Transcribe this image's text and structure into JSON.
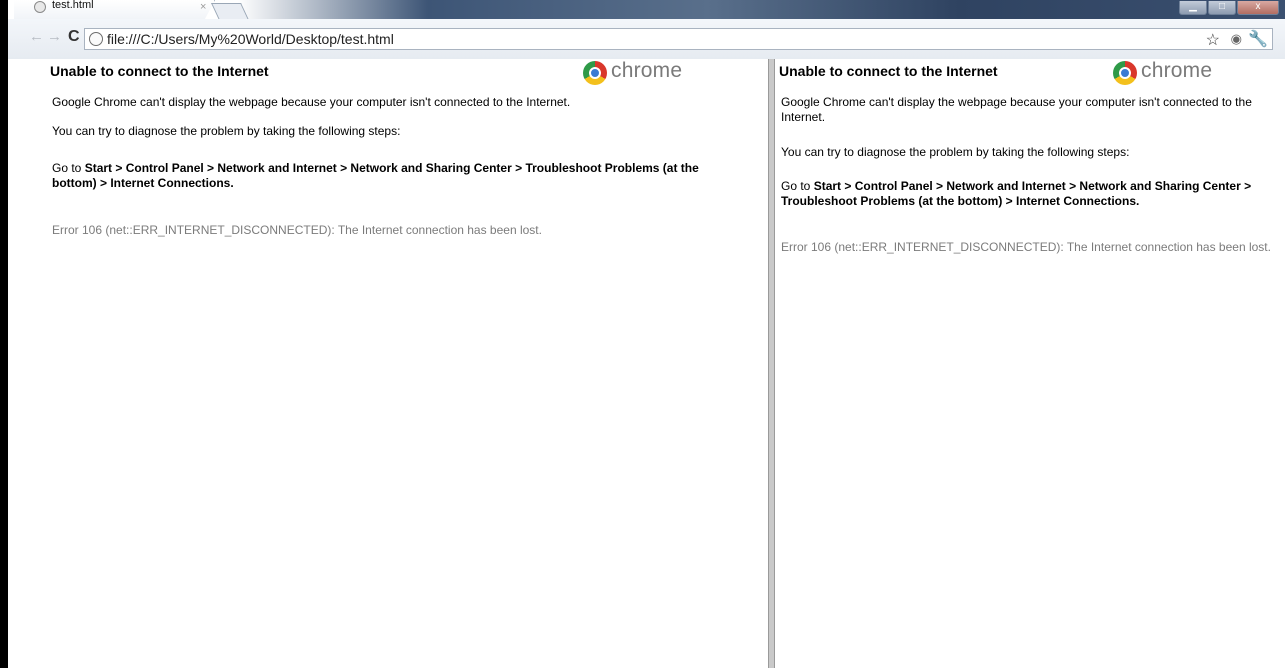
{
  "tab": {
    "title": "test.html",
    "close": "×"
  },
  "window_controls": {
    "minimize": "▁",
    "maximize": "□",
    "close": "x"
  },
  "toolbar": {
    "back": "←",
    "forward": "→",
    "reload": "C",
    "url": "file:///C:/Users/My%20World/Desktop/test.html"
  },
  "error_page": {
    "title": "Unable to connect to the Internet",
    "logo_text": "chrome",
    "line1": "Google Chrome can't display the webpage because your computer isn't connected to the Internet.",
    "line1_a": "Google Chrome can't display the webpage because your computer isn't connected to the",
    "line1_b": "Internet.",
    "line2": "You can try to diagnose the problem by taking the following steps:",
    "goto_prefix": "Go to ",
    "steps_left_a": "Start > Control Panel > Network and Internet > Network and Sharing Center > Troubleshoot Problems (at the",
    "steps_left_b": "bottom) > Internet Connections.",
    "steps_right_a": "Start > Control Panel > Network and Internet > Network and Sharing Center >",
    "steps_right_b": "Troubleshoot Problems (at the bottom) > Internet Connections.",
    "error_code": "Error 106 (net::ERR_INTERNET_DISCONNECTED): The Internet connection has been lost."
  }
}
